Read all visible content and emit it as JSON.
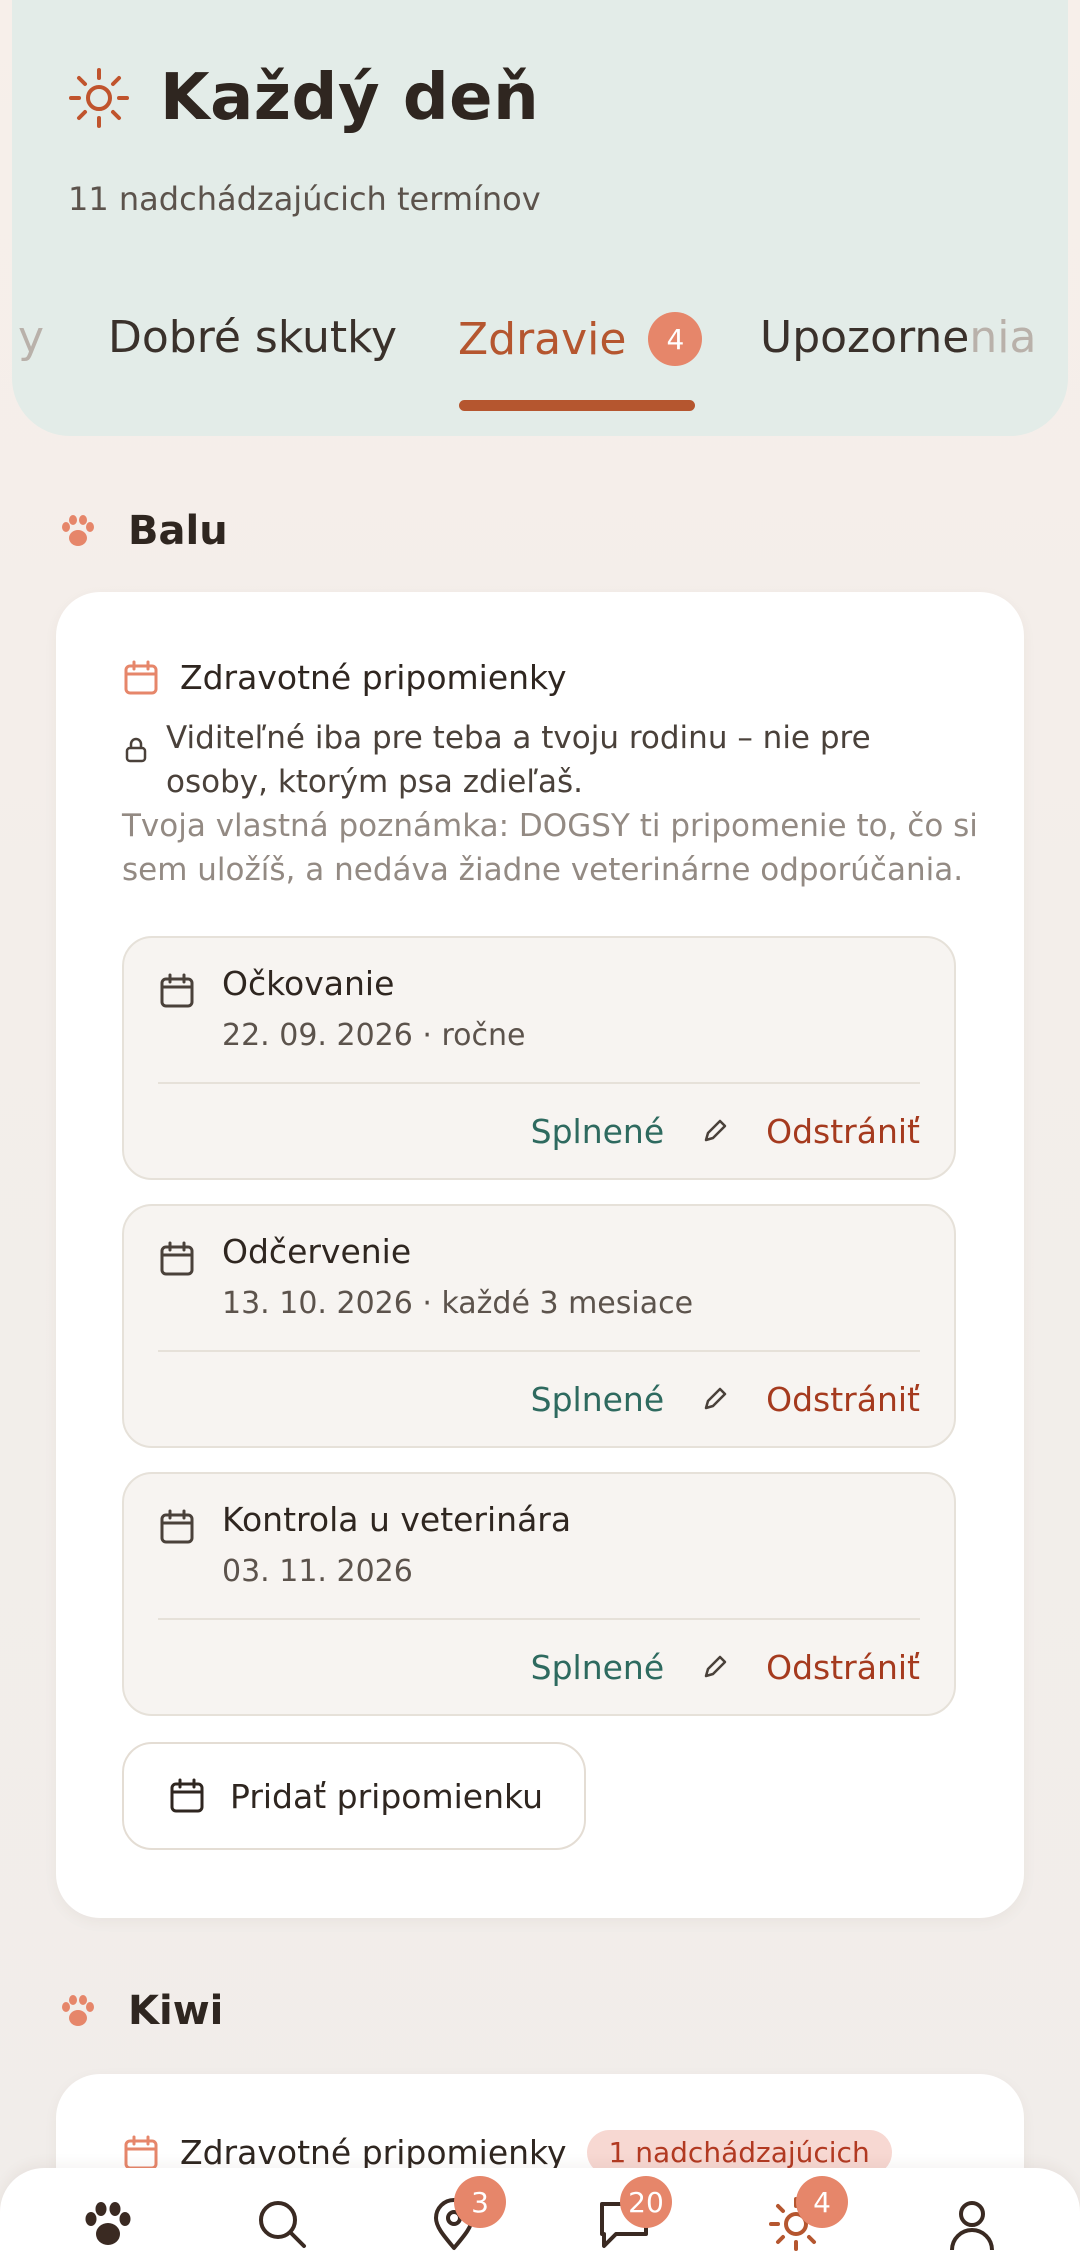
{
  "header": {
    "title": "Každý deň",
    "subtitle": "11 nadchádzajúcich termínov",
    "icon": "sun-icon"
  },
  "tabs": {
    "partial_left": "y",
    "items": [
      {
        "label": "Dobré skutky"
      },
      {
        "label": "Zdravie",
        "badge": "4",
        "active": true
      },
      {
        "label_visible": "Upozorne",
        "label_faded": "nia"
      }
    ]
  },
  "pets": [
    {
      "name": "Balu",
      "card_title": "Zdravotné pripomienky",
      "privacy_text": "Viditeľné iba pre teba a tvoju rodinu – nie pre osoby, ktorým psa zdieľaš.",
      "note": "Tvoja vlastná poznámka: DOGSY ti pripomenie to, čo si sem uložíš, a nedáva žiadne veterinárne odporúčania.",
      "reminders": [
        {
          "name": "Očkovanie",
          "date": "22. 09. 2026 · ročne"
        },
        {
          "name": "Odčervenie",
          "date": "13. 10. 2026 · každé 3 mesiace"
        },
        {
          "name": "Kontrola u veterinára",
          "date": "03. 11. 2026"
        }
      ],
      "done_label": "Splnené",
      "delete_label": "Odstrániť",
      "add_label": "Pridať pripomienku"
    },
    {
      "name": "Kiwi",
      "card_title": "Zdravotné pripomienky",
      "count_pill": "1 nadchádzajúcich"
    }
  ],
  "bottom_nav": [
    {
      "icon": "paw-icon"
    },
    {
      "icon": "search-icon"
    },
    {
      "icon": "map-pin-icon",
      "badge": "3"
    },
    {
      "icon": "chat-icon",
      "badge": "20"
    },
    {
      "icon": "sun-icon",
      "badge": "4"
    },
    {
      "icon": "profile-icon"
    }
  ],
  "colors": {
    "accent": "#b5562f",
    "badge": "#e6866a",
    "header_bg": "#e3ece8",
    "done": "#2e6a5f",
    "delete": "#a53a1e"
  }
}
